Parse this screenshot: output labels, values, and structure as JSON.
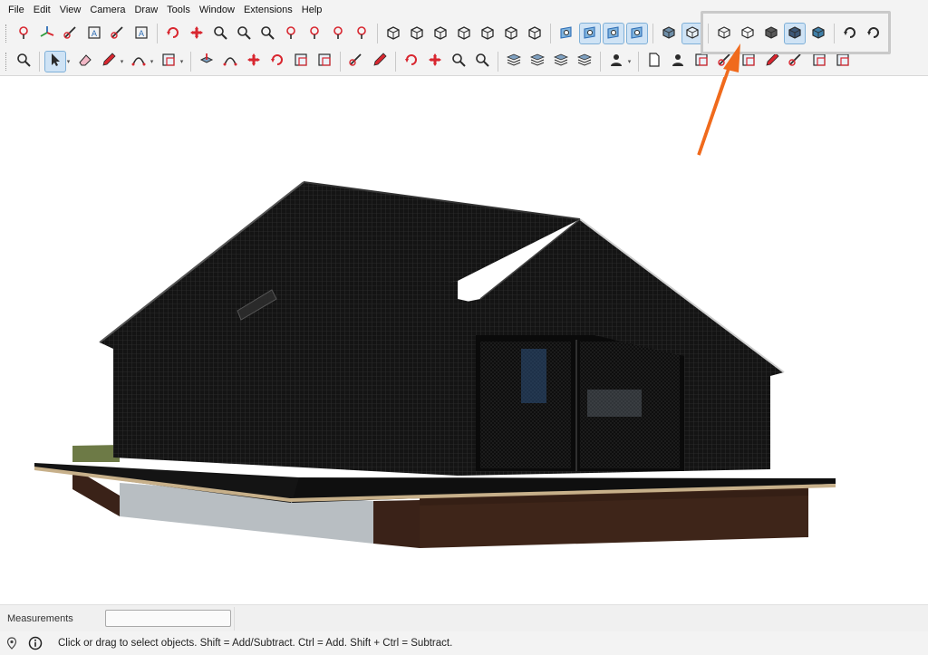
{
  "menu": [
    "File",
    "Edit",
    "View",
    "Camera",
    "Draw",
    "Tools",
    "Window",
    "Extensions",
    "Help"
  ],
  "toolbar1": [
    {
      "name": "position-camera-icon"
    },
    {
      "name": "axes-icon"
    },
    {
      "name": "protractor-icon"
    },
    {
      "name": "text-icon"
    },
    {
      "name": "dimension-icon"
    },
    {
      "name": "3d-text-icon"
    },
    {
      "sep": true
    },
    {
      "name": "orbit-icon"
    },
    {
      "name": "pan-icon"
    },
    {
      "name": "zoom-icon"
    },
    {
      "name": "zoom-window-icon"
    },
    {
      "name": "zoom-extents-icon"
    },
    {
      "name": "previous-view-icon"
    },
    {
      "name": "position-camera-2-icon"
    },
    {
      "name": "look-around-icon"
    },
    {
      "name": "walk-icon"
    },
    {
      "sep": true
    },
    {
      "name": "iso-view-icon"
    },
    {
      "name": "top-view-icon"
    },
    {
      "name": "front-view-icon"
    },
    {
      "name": "right-view-icon"
    },
    {
      "name": "back-view-icon"
    },
    {
      "name": "left-view-icon"
    },
    {
      "name": "bottom-view-icon"
    },
    {
      "sep": true
    },
    {
      "name": "section-plane-icon"
    },
    {
      "name": "display-section-planes-icon",
      "active": true
    },
    {
      "name": "display-section-cuts-icon",
      "active": true
    },
    {
      "name": "display-section-fill-icon",
      "active": true
    },
    {
      "sep": true
    },
    {
      "name": "xray-icon"
    },
    {
      "name": "back-edges-icon",
      "active": true
    },
    {
      "sep": true
    },
    {
      "name": "wireframe-icon"
    },
    {
      "name": "hidden-line-icon"
    },
    {
      "name": "shaded-icon"
    },
    {
      "name": "shaded-textures-icon",
      "active": true
    },
    {
      "name": "monochrome-icon"
    },
    {
      "sep": true
    },
    {
      "name": "refresh-icon"
    },
    {
      "name": "undo-icon"
    }
  ],
  "toolbar2": [
    {
      "name": "zoom-icon"
    },
    {
      "sep": true
    },
    {
      "name": "select-icon",
      "active": true,
      "arrow": true
    },
    {
      "name": "eraser-icon"
    },
    {
      "name": "pencil-icon",
      "arrow": true
    },
    {
      "name": "arc-icon",
      "arrow": true
    },
    {
      "name": "rectangle-icon",
      "arrow": true
    },
    {
      "sep": true
    },
    {
      "name": "push-pull-icon"
    },
    {
      "name": "follow-me-icon"
    },
    {
      "name": "move-icon"
    },
    {
      "name": "rotate-icon"
    },
    {
      "name": "scale-icon"
    },
    {
      "name": "offset-icon"
    },
    {
      "sep": true
    },
    {
      "name": "tape-measure-icon"
    },
    {
      "name": "paint-bucket-icon"
    },
    {
      "sep": true
    },
    {
      "name": "orbit-icon"
    },
    {
      "name": "pan-icon"
    },
    {
      "name": "zoom-icon"
    },
    {
      "name": "zoom-extents-icon"
    },
    {
      "sep": true
    },
    {
      "name": "warehouse-icon"
    },
    {
      "name": "extension-warehouse-icon"
    },
    {
      "name": "layers-icon"
    },
    {
      "name": "sandbox-icon"
    },
    {
      "sep": true
    },
    {
      "name": "account-icon",
      "arrow": true
    },
    {
      "sep": true
    },
    {
      "name": "new-file-icon"
    },
    {
      "name": "user-icon"
    },
    {
      "name": "layout-icon"
    },
    {
      "name": "dimension-icon"
    },
    {
      "name": "component-icon"
    },
    {
      "name": "paint-icon"
    },
    {
      "name": "tape-icon"
    },
    {
      "name": "outliner-icon"
    },
    {
      "name": "materials-icon"
    }
  ],
  "colors": {
    "accent_arrow": "#f06a1c",
    "active_bg": "#cfe3f5",
    "highlight_border": "#c9c9c9",
    "wall_dark": "#1b1b1b",
    "base_brown": "#3a2218"
  },
  "measurements": {
    "label": "Measurements",
    "value": ""
  },
  "status": {
    "text": "Click or drag to select objects. Shift = Add/Subtract. Ctrl = Add. Shift + Ctrl = Subtract."
  }
}
